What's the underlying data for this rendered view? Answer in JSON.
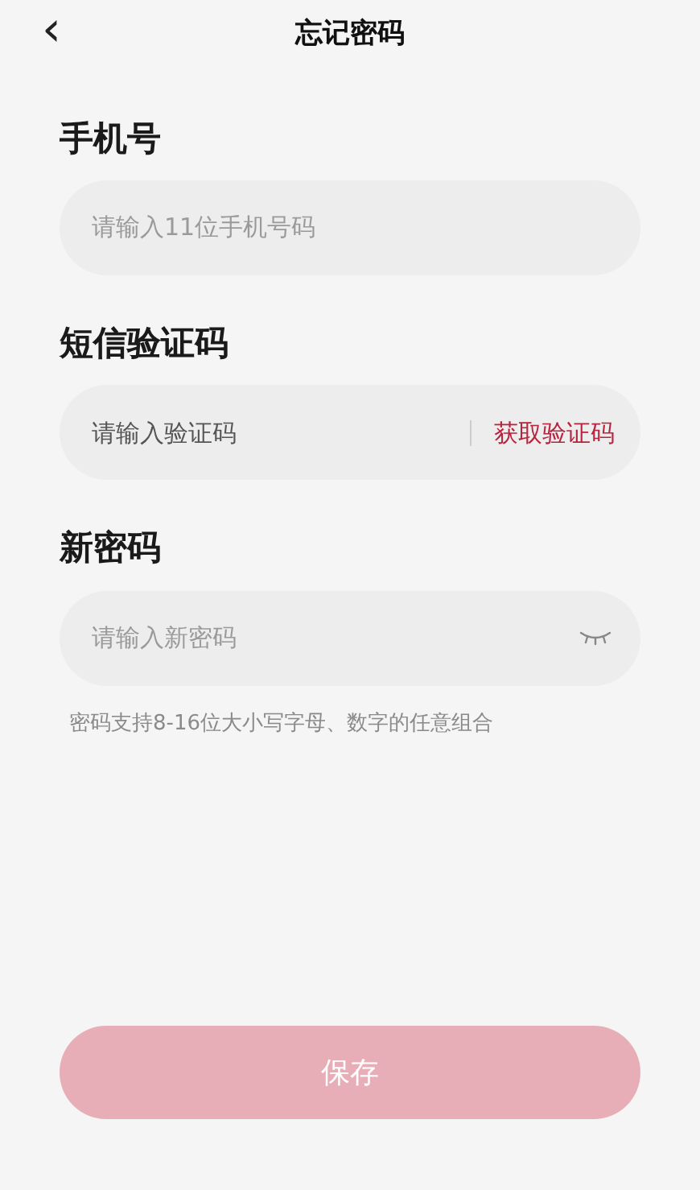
{
  "header": {
    "back": "‹",
    "title": "忘记密码"
  },
  "fields": [
    {
      "kind": "phone",
      "label": "手机号",
      "placeholder": "请输入11位手机号码"
    },
    {
      "kind": "code",
      "label": "短信验证码",
      "placeholder": "请输入验证码",
      "action": "获取验证码"
    },
    {
      "kind": "password",
      "label": "新密码",
      "placeholder": "请输入新密码",
      "hint": "密码支持8-16位大小写字母、数字的任意组合"
    }
  ],
  "save_button": {
    "label": "保存",
    "disabled": true
  }
}
